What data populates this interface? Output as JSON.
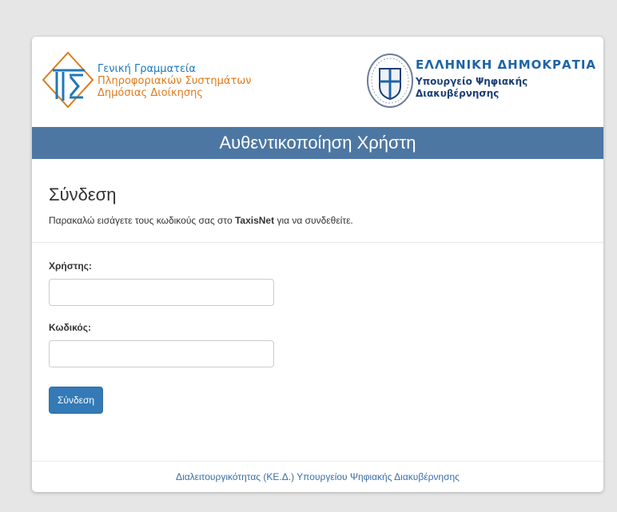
{
  "header": {
    "gsis_line1": "Γενική Γραμματεία",
    "gsis_line2": "Πληροφοριακών Συστημάτων",
    "gsis_line3": "Δημόσιας Διοίκησης",
    "gov_title": "ΕΛΛΗΝΙΚΗ ΔΗΜΟΚΡΑΤΙΑ",
    "ministry_line1": "Υπουργείο Ψηφιακής",
    "ministry_line2": "Διακυβέρνησης",
    "logo_icon": "gsis-logo-icon",
    "seal_icon": "hellenic-republic-seal-icon"
  },
  "banner": {
    "title": "Αυθεντικοποίηση Χρήστη"
  },
  "main": {
    "title": "Σύνδεση",
    "intro_before": "Παρακαλώ εισάγετε τους κωδικούς σας στο ",
    "intro_bold": "TaxisNet",
    "intro_after": " για να συνδεθείτε.",
    "username_label": "Χρήστης:",
    "username_value": "",
    "password_label": "Κωδικός:",
    "password_value": "",
    "submit_label": "Σύνδεση"
  },
  "footer": {
    "text": "Διαλειτουργικότητας (ΚΕ.Δ.) Υπουργείου Ψηφιακής Διακυβέρνησης"
  },
  "colors": {
    "page_bg": "#e6e6e6",
    "banner_bg": "#4d77a3",
    "button_bg": "#337ab7",
    "gsis_blue": "#1f78b8",
    "gsis_orange": "#e07a1a",
    "gov_blue": "#1d64a8"
  }
}
